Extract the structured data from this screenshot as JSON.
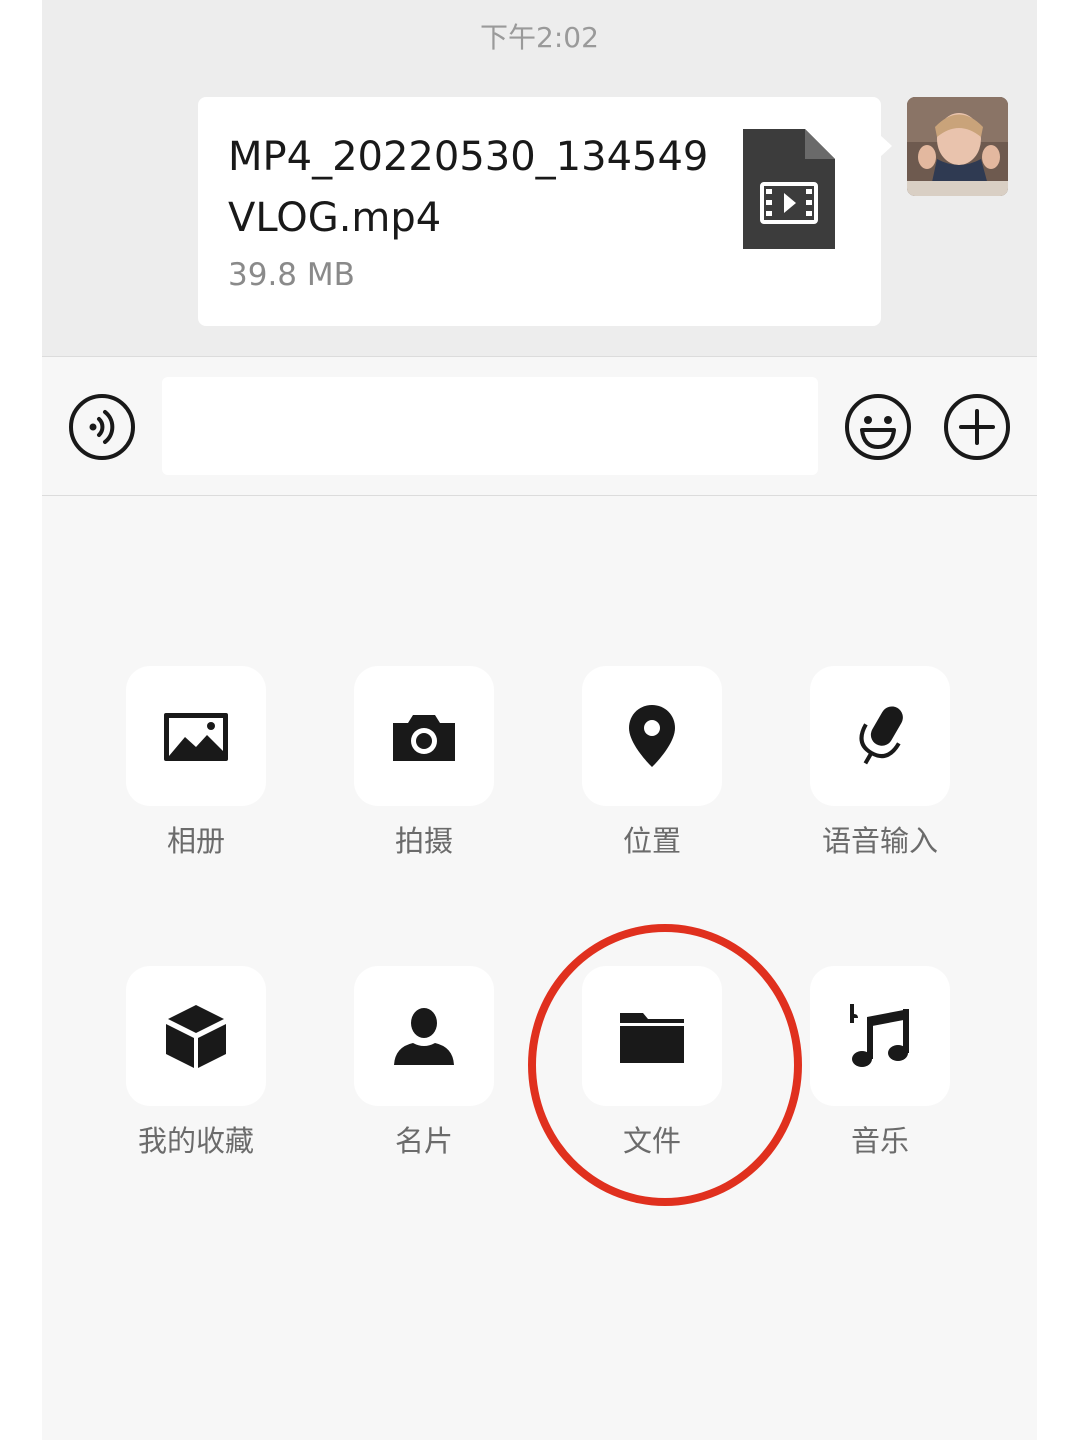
{
  "chat": {
    "timestamp": "下午2:02",
    "file_message": {
      "name": "MP4_20220530_134549VLOG.mp4",
      "size": "39.8 MB",
      "icon": "video-file-icon"
    },
    "avatar_icon": "user-avatar"
  },
  "input_bar": {
    "voice_icon": "voice-icon",
    "input_value": "",
    "emoji_icon": "emoji-icon",
    "plus_icon": "plus-icon"
  },
  "tools": [
    {
      "label": "相册",
      "icon": "album-icon"
    },
    {
      "label": "拍摄",
      "icon": "camera-icon"
    },
    {
      "label": "位置",
      "icon": "location-icon"
    },
    {
      "label": "语音输入",
      "icon": "microphone-icon"
    },
    {
      "label": "我的收藏",
      "icon": "favorites-cube-icon"
    },
    {
      "label": "名片",
      "icon": "contact-card-icon"
    },
    {
      "label": "文件",
      "icon": "folder-icon"
    },
    {
      "label": "音乐",
      "icon": "music-note-icon"
    }
  ],
  "colors": {
    "highlight": "#e0301e",
    "chat_bg": "#ededed",
    "panel_bg": "#f7f7f7",
    "icon": "#191919"
  }
}
